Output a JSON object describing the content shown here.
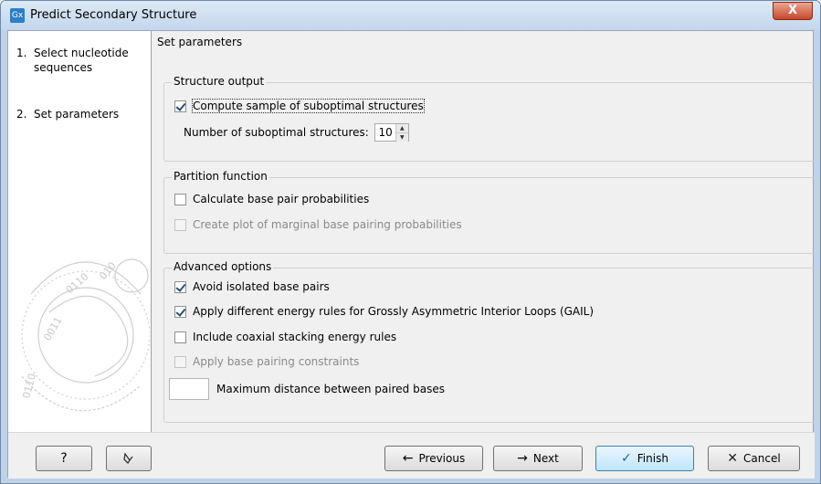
{
  "window": {
    "title": "Predict Secondary Structure",
    "app_icon_text": "Gx",
    "close_glyph": "X"
  },
  "steps": [
    {
      "num": "1.",
      "label": "Select nucleotide sequences"
    },
    {
      "num": "2.",
      "label": "Set parameters"
    }
  ],
  "panel": {
    "title": "Set parameters"
  },
  "structure_output": {
    "title": "Structure output",
    "compute_sample_label": "Compute sample of suboptimal structures",
    "compute_sample_checked": true,
    "num_suboptimal_label": "Number of suboptimal structures:",
    "num_suboptimal_value": "10"
  },
  "partition_function": {
    "title": "Partition function",
    "calc_base_pair_label": "Calculate base pair probabilities",
    "calc_base_pair_checked": false,
    "create_plot_label": "Create plot of marginal base pairing probabilities",
    "create_plot_checked": false,
    "create_plot_enabled": false
  },
  "advanced_options": {
    "title": "Advanced options",
    "avoid_isolated_label": "Avoid isolated base pairs",
    "avoid_isolated_checked": true,
    "gail_label": "Apply different energy rules for Grossly Asymmetric Interior Loops (GAIL)",
    "gail_checked": true,
    "coaxial_label": "Include coaxial stacking energy rules",
    "coaxial_checked": false,
    "constraints_label": "Apply base pairing constraints",
    "constraints_checked": false,
    "constraints_enabled": false,
    "max_distance_label": "Maximum distance between paired bases",
    "max_distance_value": ""
  },
  "footer": {
    "help_label": "?",
    "previous_label": "Previous",
    "next_label": "Next",
    "finish_label": "Finish",
    "cancel_label": "Cancel"
  },
  "icons": {
    "close": "close-icon",
    "help": "question-icon",
    "reset": "reset-icon",
    "previous": "arrow-left-icon",
    "next": "arrow-right-icon",
    "finish": "checkmark-icon",
    "cancel": "x-icon"
  }
}
